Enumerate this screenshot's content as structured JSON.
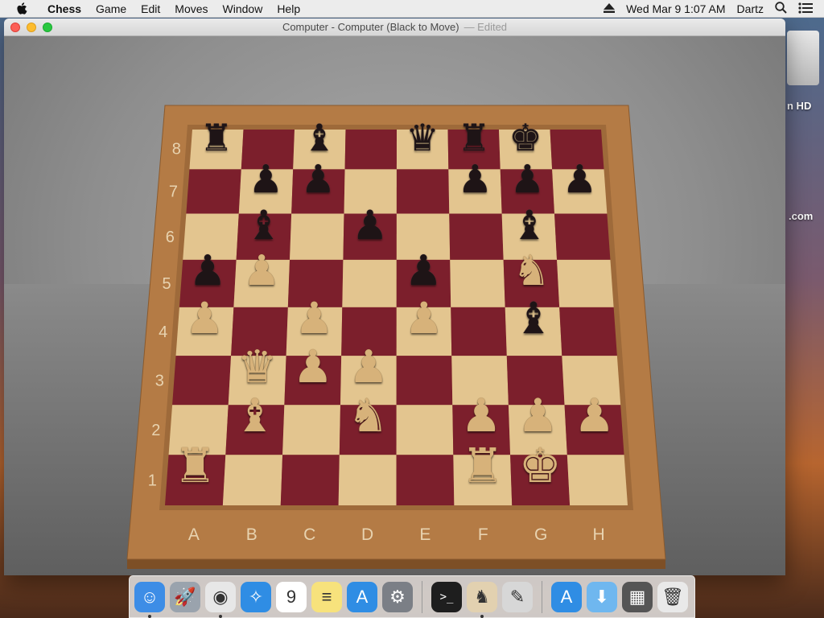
{
  "menubar": {
    "app_name": "Chess",
    "items": [
      "Game",
      "Edit",
      "Moves",
      "Window",
      "Help"
    ],
    "clock": "Wed Mar 9  1:07 AM",
    "user": "Dartz"
  },
  "desktop": {
    "disk_label": "n HD",
    "site_label": ".com"
  },
  "window": {
    "title": "Computer - Computer   (Black to Move)",
    "edited": "— Edited"
  },
  "board": {
    "files": [
      "A",
      "B",
      "C",
      "D",
      "E",
      "F",
      "G",
      "H"
    ],
    "ranks": [
      "1",
      "2",
      "3",
      "4",
      "5",
      "6",
      "7",
      "8"
    ],
    "colors": {
      "light": "#e3c58f",
      "dark": "#7c1f2c",
      "frame": "#b47b45"
    },
    "pieces": [
      {
        "square": "a8",
        "color": "black",
        "type": "rook"
      },
      {
        "square": "c8",
        "color": "black",
        "type": "bishop"
      },
      {
        "square": "e8",
        "color": "black",
        "type": "queen"
      },
      {
        "square": "f8",
        "color": "black",
        "type": "rook"
      },
      {
        "square": "g8",
        "color": "black",
        "type": "king"
      },
      {
        "square": "b7",
        "color": "black",
        "type": "pawn"
      },
      {
        "square": "c7",
        "color": "black",
        "type": "pawn"
      },
      {
        "square": "f7",
        "color": "black",
        "type": "pawn"
      },
      {
        "square": "g7",
        "color": "black",
        "type": "pawn"
      },
      {
        "square": "h7",
        "color": "black",
        "type": "pawn"
      },
      {
        "square": "b6",
        "color": "black",
        "type": "bishop"
      },
      {
        "square": "d6",
        "color": "black",
        "type": "pawn"
      },
      {
        "square": "g6",
        "color": "black",
        "type": "bishop"
      },
      {
        "square": "a5",
        "color": "black",
        "type": "pawn"
      },
      {
        "square": "e5",
        "color": "black",
        "type": "pawn"
      },
      {
        "square": "g4",
        "color": "black",
        "type": "bishop"
      },
      {
        "square": "b5",
        "color": "white",
        "type": "pawn"
      },
      {
        "square": "g5",
        "color": "white",
        "type": "knight"
      },
      {
        "square": "a4",
        "color": "white",
        "type": "pawn"
      },
      {
        "square": "c4",
        "color": "white",
        "type": "pawn"
      },
      {
        "square": "e4",
        "color": "white",
        "type": "pawn"
      },
      {
        "square": "b3",
        "color": "white",
        "type": "queen"
      },
      {
        "square": "c3",
        "color": "white",
        "type": "pawn"
      },
      {
        "square": "d3",
        "color": "white",
        "type": "pawn"
      },
      {
        "square": "b2",
        "color": "white",
        "type": "bishop"
      },
      {
        "square": "d2",
        "color": "white",
        "type": "knight"
      },
      {
        "square": "f2",
        "color": "white",
        "type": "pawn"
      },
      {
        "square": "g2",
        "color": "white",
        "type": "pawn"
      },
      {
        "square": "h2",
        "color": "white",
        "type": "pawn"
      },
      {
        "square": "a1",
        "color": "white",
        "type": "rook"
      },
      {
        "square": "f1",
        "color": "white",
        "type": "rook"
      },
      {
        "square": "g1",
        "color": "white",
        "type": "king"
      }
    ]
  },
  "dock": {
    "items": [
      {
        "name": "finder-icon",
        "glyph": "☺",
        "bg": "#3d8de6",
        "running": true
      },
      {
        "name": "launchpad-icon",
        "glyph": "🚀",
        "bg": "#9aa3ad",
        "running": false
      },
      {
        "name": "chrome-icon",
        "glyph": "◉",
        "bg": "#e7e7e7",
        "running": true
      },
      {
        "name": "safari-icon",
        "glyph": "✧",
        "bg": "#2f8de4",
        "running": false
      },
      {
        "name": "calendar-icon",
        "glyph": "9",
        "bg": "#ffffff",
        "running": false
      },
      {
        "name": "notes-icon",
        "glyph": "≡",
        "bg": "#f7e27c",
        "running": false
      },
      {
        "name": "app-store-icon",
        "glyph": "A",
        "bg": "#2f8de4",
        "running": false
      },
      {
        "name": "system-preferences-icon",
        "glyph": "⚙",
        "bg": "#7b7f86",
        "running": false
      },
      {
        "name": "terminal-icon",
        "glyph": ">_",
        "bg": "#1e1e1e",
        "running": false
      },
      {
        "name": "chess-icon",
        "glyph": "♞",
        "bg": "#e2d1b0",
        "running": true
      },
      {
        "name": "utility-icon",
        "glyph": "✎",
        "bg": "#d7d7d7",
        "running": false
      },
      {
        "name": "app-store-downloads-icon",
        "glyph": "A",
        "bg": "#2f8de4",
        "running": false
      },
      {
        "name": "downloads-folder-icon",
        "glyph": "⬇",
        "bg": "#6fb7ef",
        "running": false
      },
      {
        "name": "screenshot-stack-icon",
        "glyph": "▦",
        "bg": "#555555",
        "running": false
      },
      {
        "name": "trash-icon",
        "glyph": "🗑",
        "bg": "#e9e9e9",
        "running": false
      }
    ]
  }
}
